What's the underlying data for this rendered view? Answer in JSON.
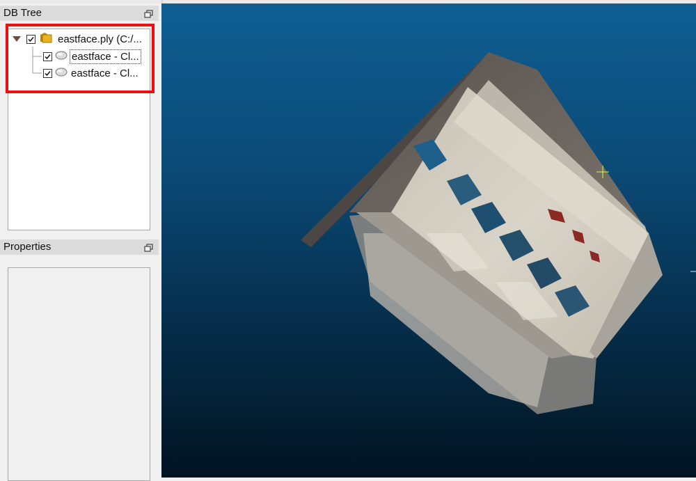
{
  "db_tree": {
    "title": "DB Tree",
    "items": [
      {
        "label": "eastface.ply (C:/...",
        "checked": true,
        "icon": "folder-icon",
        "expanded": true
      },
      {
        "label": "eastface - Cl...",
        "checked": true,
        "icon": "point-cloud-icon"
      },
      {
        "label": "eastface - Cl...",
        "checked": true,
        "icon": "point-cloud-icon"
      }
    ]
  },
  "properties": {
    "title": "Properties"
  },
  "colors": {
    "highlight": "#e81010",
    "viewport_top": "#0f5e93",
    "viewport_bottom": "#011421"
  }
}
